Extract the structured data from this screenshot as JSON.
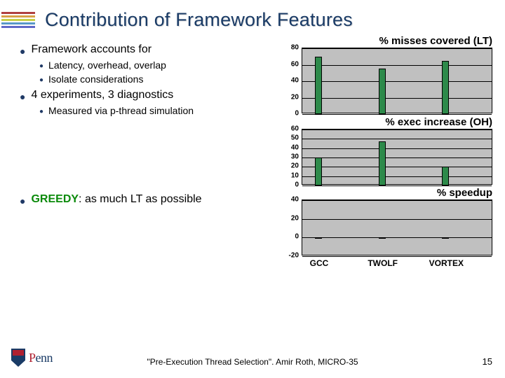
{
  "title": "Contribution of Framework Features",
  "bullets": {
    "b1": "Framework accounts for",
    "b1a": "Latency, overhead, overlap",
    "b1b": "Isolate considerations",
    "b2": "4 experiments, 3 diagnostics",
    "b2a": "Measured via p-thread simulation",
    "greedy_label": "GREEDY",
    "greedy_rest": ": as much LT as possible"
  },
  "footer": "\"Pre-Execution Thread Selection\".  Amir Roth, MICRO-35",
  "pagenum": "15",
  "logo": {
    "text1": "P",
    "text2": "enn"
  },
  "chart_data": [
    {
      "type": "bar",
      "title": "% misses covered (LT)",
      "categories": [
        "GCC",
        "TWOLF",
        "VORTEX"
      ],
      "series": [
        {
          "name": "GREEDY",
          "values": [
            70,
            55,
            65
          ]
        }
      ],
      "ylim": [
        0,
        80
      ],
      "yticks": [
        0,
        20,
        40,
        60,
        80
      ],
      "xlabel": "",
      "ylabel": ""
    },
    {
      "type": "bar",
      "title": "% exec increase (OH)",
      "categories": [
        "GCC",
        "TWOLF",
        "VORTEX"
      ],
      "series": [
        {
          "name": "GREEDY",
          "values": [
            30,
            47,
            20
          ]
        }
      ],
      "ylim": [
        0,
        60
      ],
      "yticks": [
        0,
        10,
        20,
        30,
        40,
        50,
        60
      ],
      "xlabel": "",
      "ylabel": ""
    },
    {
      "type": "bar",
      "title": "% speedup",
      "categories": [
        "GCC",
        "TWOLF",
        "VORTEX"
      ],
      "series": [
        {
          "name": "GREEDY",
          "values": [
            0,
            0,
            0
          ]
        }
      ],
      "ylim": [
        -20,
        40
      ],
      "yticks": [
        -20,
        0,
        20,
        40
      ],
      "xlabel": "",
      "ylabel": ""
    }
  ]
}
